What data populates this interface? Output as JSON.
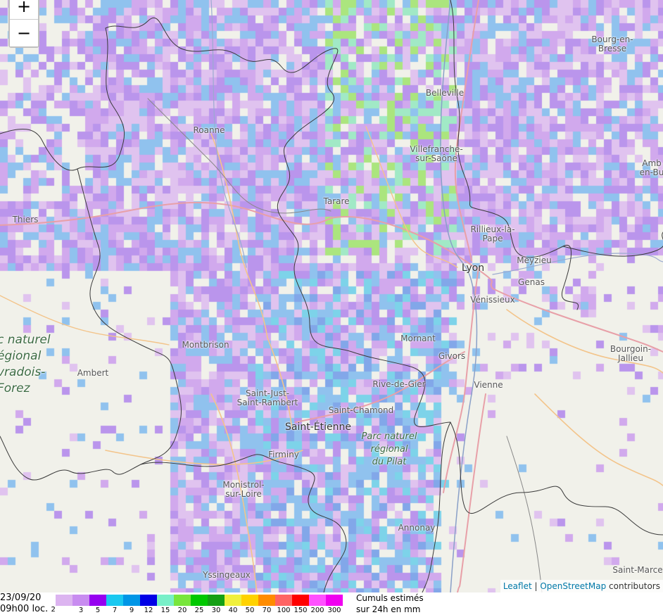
{
  "zoom": {
    "in_label": "+",
    "out_label": "−"
  },
  "places": [
    {
      "name": "Bourg-en-\nBresse",
      "key": "bourg",
      "style": "normal"
    },
    {
      "name": "Belleville",
      "key": "belleville",
      "style": "normal"
    },
    {
      "name": "Roanne",
      "key": "roanne",
      "style": "normal"
    },
    {
      "name": "Villefranche-\nsur-Saône",
      "key": "villefranche",
      "style": "normal"
    },
    {
      "name": "Amb\nen-Bu",
      "key": "amberieu",
      "style": "normal"
    },
    {
      "name": "Tarare",
      "key": "tarare",
      "style": "normal"
    },
    {
      "name": "Thiers",
      "key": "thiers",
      "style": "normal"
    },
    {
      "name": "Rillieux-la-\nPape",
      "key": "rillieux",
      "style": "normal"
    },
    {
      "name": "Lyon",
      "key": "lyon",
      "style": "big"
    },
    {
      "name": "Meyzieu",
      "key": "meyzieu",
      "style": "normal"
    },
    {
      "name": "Genas",
      "key": "genas",
      "style": "normal"
    },
    {
      "name": "Vénissieux",
      "key": "venissieux",
      "style": "normal"
    },
    {
      "name": "c naturel\négional\nvradois-\nForez",
      "key": "livradois",
      "style": "park-huge"
    },
    {
      "name": "Montbrison",
      "key": "montbrison",
      "style": "normal"
    },
    {
      "name": "Mornant",
      "key": "mornant",
      "style": "normal"
    },
    {
      "name": "Givors",
      "key": "givors",
      "style": "normal"
    },
    {
      "name": "Bourgoin-\nJallieu",
      "key": "bourgoin",
      "style": "normal"
    },
    {
      "name": "Ambert",
      "key": "ambert",
      "style": "normal"
    },
    {
      "name": "Rive-de-Gier",
      "key": "rivedegier",
      "style": "normal"
    },
    {
      "name": "Vienne",
      "key": "vienne",
      "style": "normal"
    },
    {
      "name": "Saint-Just-\nSaint-Rambert",
      "key": "saintjust",
      "style": "normal"
    },
    {
      "name": "Saint-Chamond",
      "key": "saintchamond",
      "style": "normal"
    },
    {
      "name": "Saint-Étienne",
      "key": "saintetienne",
      "style": "big"
    },
    {
      "name": "Parc naturel\nrégional\ndu Pilat",
      "key": "pilat",
      "style": "park"
    },
    {
      "name": "Firminy",
      "key": "firminy",
      "style": "normal"
    },
    {
      "name": "Monistrol-\nsur-Loire",
      "key": "monistrol",
      "style": "normal"
    },
    {
      "name": "Annonay",
      "key": "annonay",
      "style": "normal"
    },
    {
      "name": "Yssingeaux",
      "key": "yssingeaux",
      "style": "normal"
    },
    {
      "name": "Saint-Marce",
      "key": "saintmarcel",
      "style": "normal"
    }
  ],
  "attribution": {
    "leaflet": "Leaflet",
    "separator": " | ",
    "osm": "OpenStreetMap",
    "suffix": " contributors"
  },
  "legend": {
    "date": "23/09/20",
    "time": "09h00 loc.",
    "first_tick": "2",
    "ticks": [
      "3",
      "5",
      "7",
      "9",
      "12",
      "15",
      "20",
      "25",
      "30",
      "40",
      "50",
      "70",
      "100",
      "150",
      "200",
      "300"
    ],
    "title_line1": "Cumuls estimés",
    "title_line2": "sur 24h en mm",
    "colors": [
      "#dcb4f0",
      "#c88cf0",
      "#9600f0",
      "#19c8f0",
      "#0096e6",
      "#0000e6",
      "#78f0c8",
      "#78e63c",
      "#00c800",
      "#14a014",
      "#f0f03c",
      "#ffd200",
      "#ff8c00",
      "#ff6464",
      "#ff0000",
      "#ff50ff",
      "#f000f0"
    ]
  },
  "radar_palette": [
    "#d9b3f0",
    "#c690ee",
    "#a776ec",
    "#6fb2ef",
    "#55c8e8",
    "#5c8ee8",
    "#86e6b9",
    "#93e05a"
  ]
}
